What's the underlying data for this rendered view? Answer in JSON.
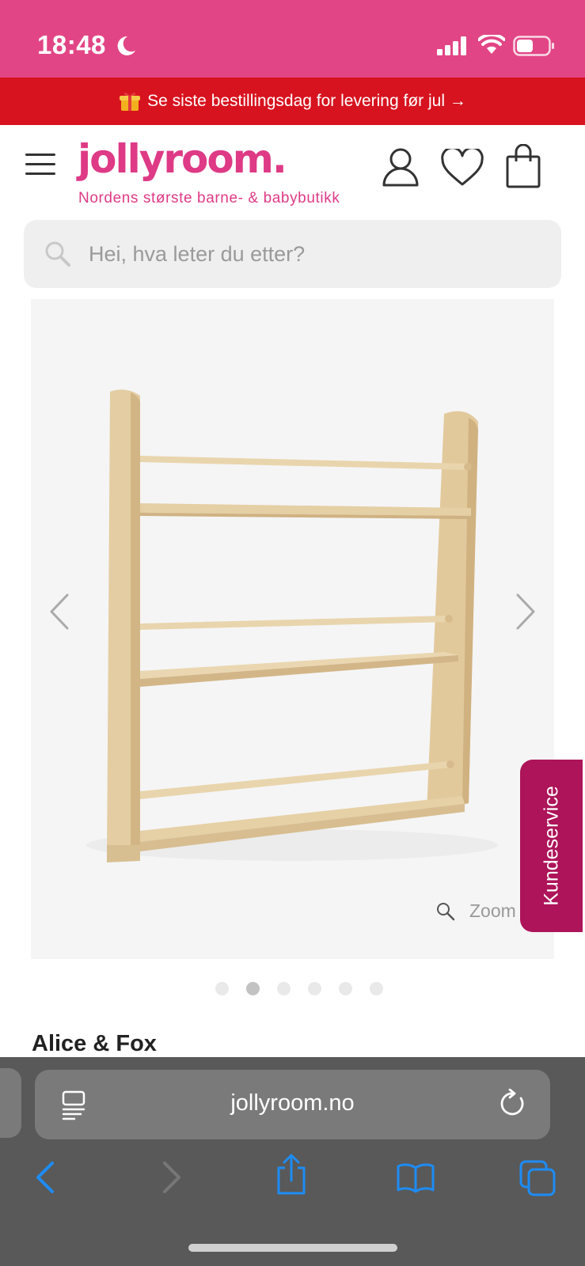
{
  "status_bar": {
    "time": "18:48",
    "icons": [
      "moon-icon",
      "signal-icon",
      "wifi-icon",
      "battery-icon"
    ]
  },
  "promo": {
    "text": "Se siste bestillingsdag for levering før jul →",
    "icon": "gift-icon"
  },
  "header": {
    "logo": "jollyroom.",
    "tagline": "Nordens største barne- & babybutikk",
    "icons": [
      "menu-icon",
      "account-icon",
      "heart-icon",
      "cart-icon"
    ]
  },
  "search": {
    "placeholder": "Hei, hva leter du etter?",
    "value": ""
  },
  "gallery": {
    "zoom_label": "Zoom",
    "image_count": 6,
    "active_index": 1
  },
  "support_tab": {
    "label": "Kundeservice"
  },
  "product": {
    "brand": "Alice & Fox"
  },
  "browser": {
    "url": "jollyroom.no",
    "toolbar": [
      "back-icon",
      "forward-icon",
      "share-icon",
      "bookmarks-icon",
      "tabs-icon"
    ]
  },
  "colors": {
    "brand_pink": "#e24585",
    "promo_red": "#d7131f",
    "support_magenta": "#ad1459",
    "browser_blue": "#1d8cf5"
  }
}
